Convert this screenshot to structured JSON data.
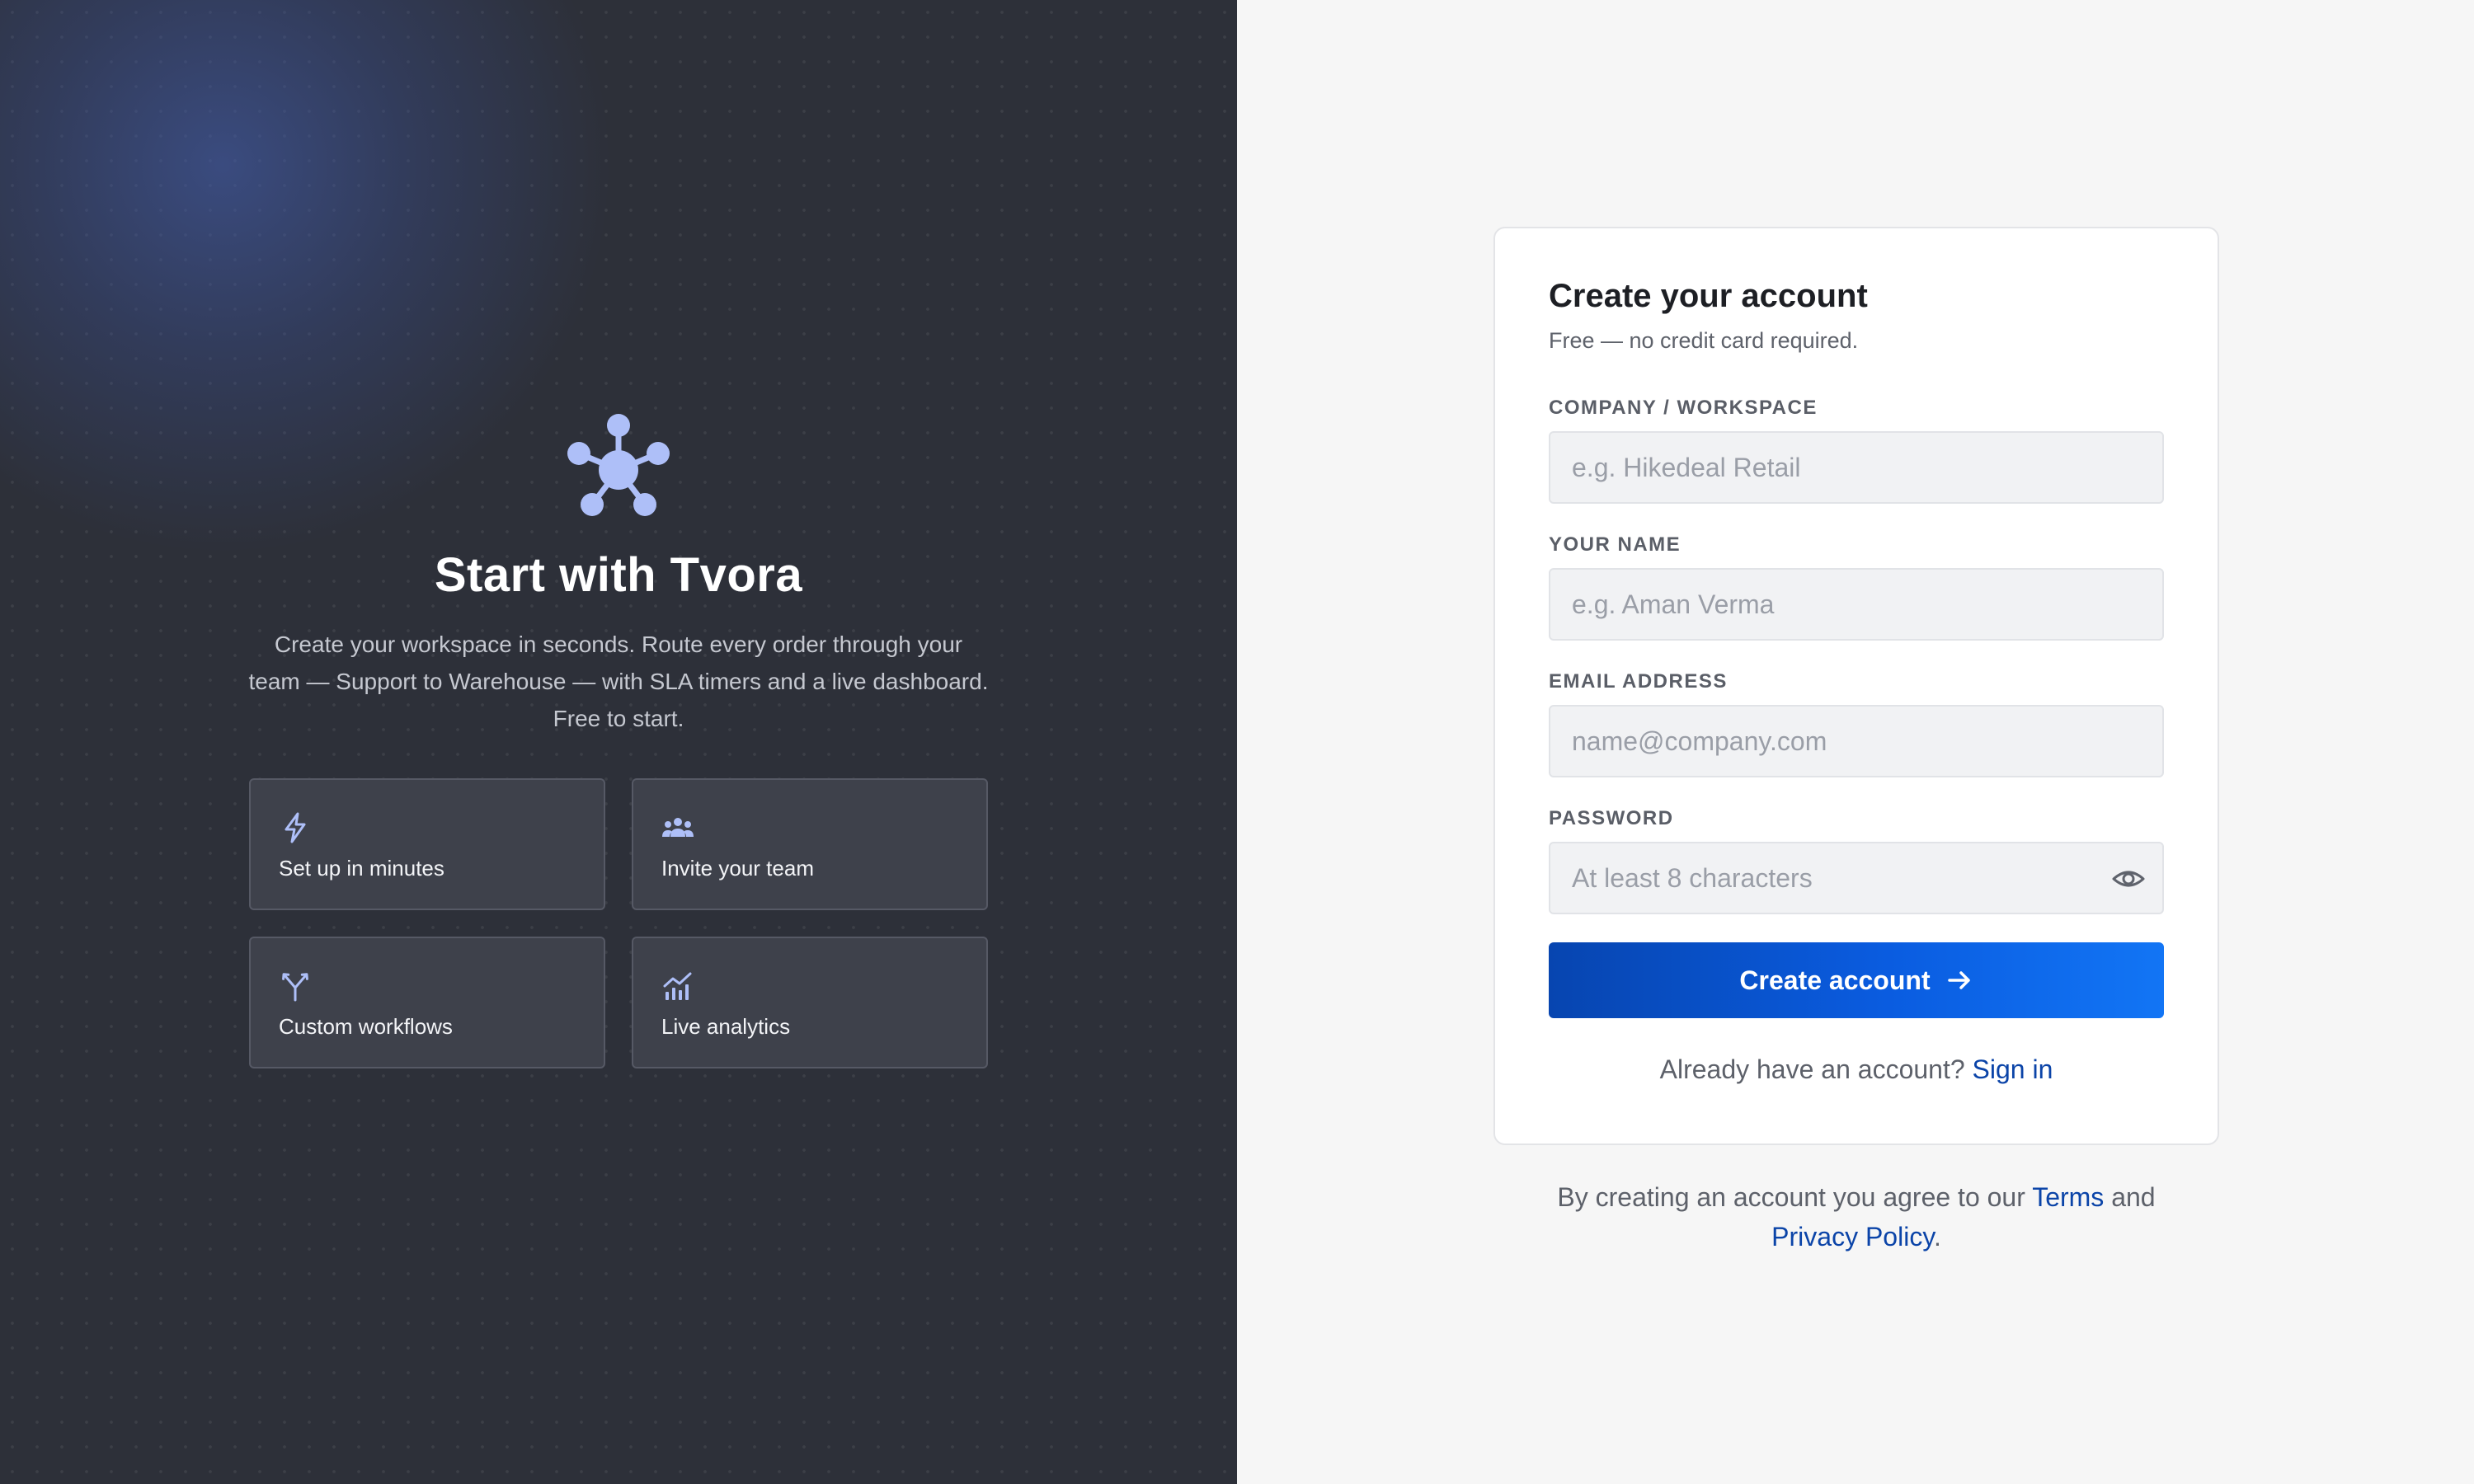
{
  "brand": {
    "name": "Tvora",
    "icon": "network-hub-icon",
    "hero_title": "Start with Tvora",
    "hero_description": "Create your workspace in seconds. Route every order through your team — Support to Warehouse — with SLA timers and a live dashboard. Free to start."
  },
  "features": [
    {
      "icon": "lightning-bolt-icon",
      "label": "Set up in minutes"
    },
    {
      "icon": "team-icon",
      "label": "Invite your team"
    },
    {
      "icon": "branching-arrows-icon",
      "label": "Custom workflows"
    },
    {
      "icon": "analytics-chart-icon",
      "label": "Live analytics"
    }
  ],
  "form": {
    "title": "Create your account",
    "subtitle": "Free — no credit card required.",
    "company": {
      "label": "COMPANY / WORKSPACE",
      "placeholder": "e.g. Hikedeal Retail",
      "value": ""
    },
    "name": {
      "label": "YOUR NAME",
      "placeholder": "e.g. Aman Verma",
      "value": ""
    },
    "email": {
      "label": "EMAIL ADDRESS",
      "placeholder": "name@company.com",
      "value": ""
    },
    "password": {
      "label": "PASSWORD",
      "placeholder": "At least 8 characters",
      "value": "",
      "toggle_icon": "eye-icon"
    },
    "submit_label": "Create account",
    "submit_icon": "arrow-right-icon",
    "signin_prompt": "Already have an account?",
    "signin_link": "Sign in"
  },
  "legal": {
    "prefix": "By creating an account you agree to our",
    "terms_link": "Terms",
    "conjunction": "and",
    "privacy_link": "Privacy Policy",
    "suffix": "."
  },
  "colors": {
    "left_background": "#2d3039",
    "accent_icon": "#aebff8",
    "primary_button_start": "#0745b0",
    "primary_button_end": "#1275f5",
    "link": "#0b44a8"
  }
}
